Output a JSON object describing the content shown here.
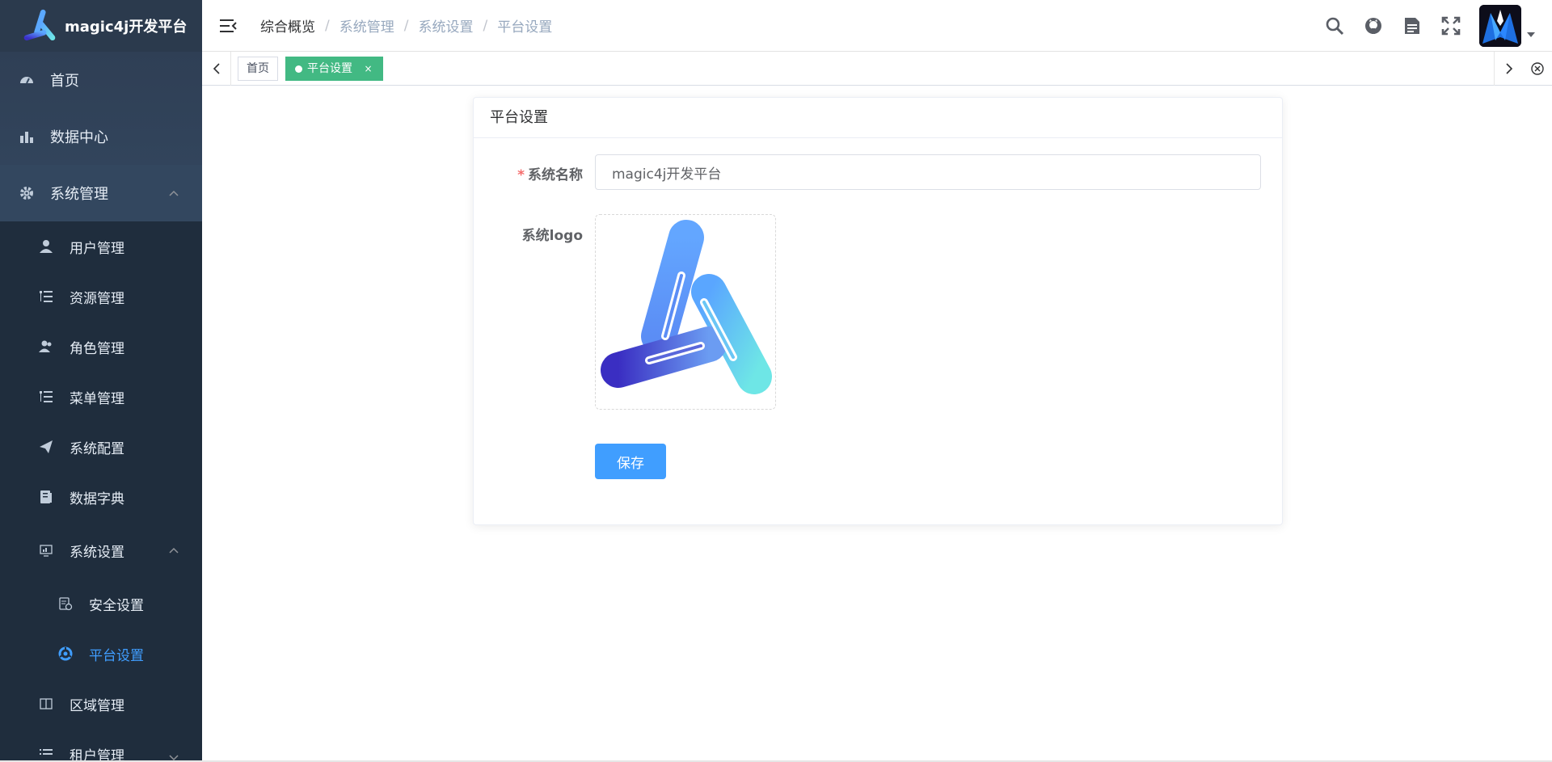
{
  "app": {
    "title": "magic4j开发平台"
  },
  "sidebar": {
    "items": [
      {
        "label": "首页",
        "icon": "dashboard-icon"
      },
      {
        "label": "数据中心",
        "icon": "bar-chart-icon"
      },
      {
        "label": "系统管理",
        "icon": "gear-icon",
        "expanded": true
      }
    ],
    "system_children": [
      {
        "label": "用户管理",
        "icon": "user-icon"
      },
      {
        "label": "资源管理",
        "icon": "tree-list-icon"
      },
      {
        "label": "角色管理",
        "icon": "users-icon"
      },
      {
        "label": "菜单管理",
        "icon": "tree-list-icon"
      },
      {
        "label": "系统配置",
        "icon": "paper-plane-icon"
      },
      {
        "label": "数据字典",
        "icon": "book-icon"
      },
      {
        "label": "系统设置",
        "icon": "monitor-icon",
        "expanded": true
      }
    ],
    "settings_children": [
      {
        "label": "安全设置",
        "icon": "shield-edit-icon"
      },
      {
        "label": "平台设置",
        "icon": "platform-icon",
        "active": true
      }
    ],
    "after_items": [
      {
        "label": "区域管理",
        "icon": "columns-icon"
      },
      {
        "label": "租户管理",
        "icon": "list-icon"
      }
    ]
  },
  "header": {
    "breadcrumb": [
      "综合概览",
      "系统管理",
      "系统设置",
      "平台设置"
    ],
    "icons": [
      "search-icon",
      "github-icon",
      "document-icon",
      "fullscreen-icon"
    ]
  },
  "tags": {
    "items": [
      {
        "label": "首页",
        "active": false
      },
      {
        "label": "平台设置",
        "active": true,
        "close": "×"
      }
    ]
  },
  "card": {
    "title": "平台设置",
    "fields": {
      "name_label": "系统名称",
      "name_required_mark": "*",
      "name_value": "magic4j开发平台",
      "logo_label": "系统logo"
    },
    "save_label": "保存"
  },
  "colors": {
    "sidebar_bg": "#1f2d3d",
    "active_menu": "#409eff",
    "tag_active": "#42b983",
    "primary_button": "#409eff"
  }
}
